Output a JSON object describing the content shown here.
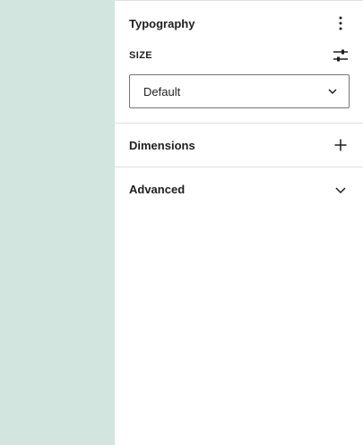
{
  "typography": {
    "title": "Typography",
    "options_icon": "more-vertical-icon",
    "size_label": "SIZE",
    "size_controls_icon": "sliders-icon",
    "size_select": {
      "selected": "Default",
      "icon": "chevron-down-icon"
    }
  },
  "dimensions": {
    "title": "Dimensions",
    "icon": "plus-icon"
  },
  "advanced": {
    "title": "Advanced",
    "icon": "chevron-down-icon"
  },
  "colors": {
    "canvas_background": "#d3e5df",
    "divider": "#e0e0e0",
    "text": "#1e1e1e",
    "select_border": "#757575"
  }
}
